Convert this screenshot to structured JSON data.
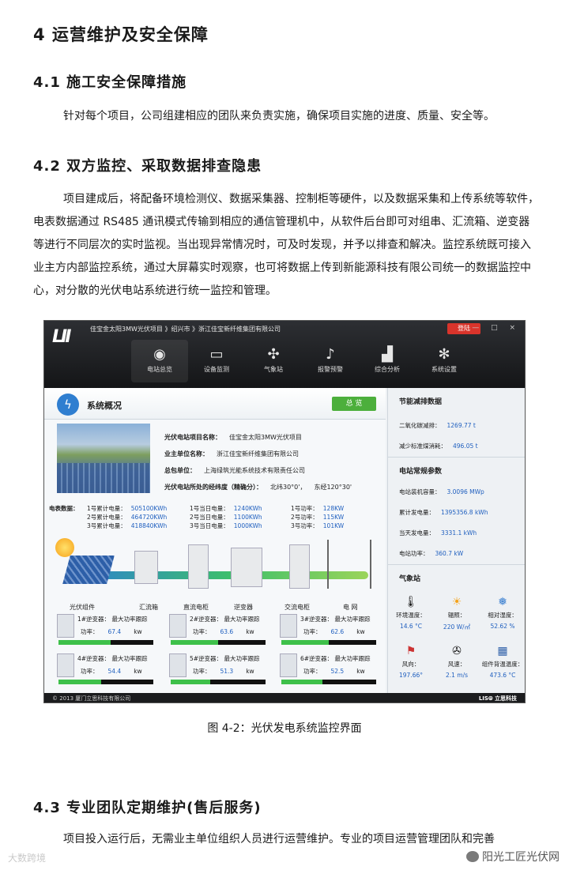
{
  "doc": {
    "h1": "4  运营维护及安全保障",
    "s41_title": "4.1  施工安全保障措施",
    "s41_text": "针对每个项目，公司组建相应的团队来负责实施，确保项目实施的进度、质量、安全等。",
    "s42_title": "4.2  双方监控、采取数据排查隐患",
    "s42_text": "项目建成后，将配备环境检测仪、数据采集器、控制柜等硬件，以及数据采集和上传系统等软件，电表数据通过 RS485 通讯模式传输到相应的通信管理机中，从软件后台即可对组串、汇流箱、逆变器等进行不同层次的实时监视。当出现异常情况时，可及时发现，并予以排查和解决。监控系统既可接入业主方内部监控系统，通过大屏幕实时观察，也可将数据上传到新能源科技有限公司统一的数据监控中心，对分散的光伏电站系统进行统一监控和管理。",
    "caption": "图 4-2：光伏发电系统监控界面",
    "s43_title": "4.3  专业团队定期维护(售后服务)",
    "s43_text": "项目投入运行后，无需业主单位组织人员进行运营维护。专业的项目运营管理团队和完善"
  },
  "watermarks": {
    "left": "大数跨境",
    "right": "阳光工匠光伏网"
  },
  "screen": {
    "logo": "LII",
    "breadcrumb": "佳宝金太阳3MW光伏项目 》绍兴市 》浙江佳宝新纤维集团有限公司",
    "window_controls": "— □ ×",
    "login": "登陆",
    "nav": [
      {
        "label": "电站总览",
        "icon": "eye-icon"
      },
      {
        "label": "设备监测",
        "icon": "monitor-icon"
      },
      {
        "label": "气象站",
        "icon": "windmill-icon"
      },
      {
        "label": "报警预警",
        "icon": "bell-icon"
      },
      {
        "label": "综合分析",
        "icon": "chart-icon"
      },
      {
        "label": "系统设置",
        "icon": "gear-icon"
      }
    ],
    "system_title": "系统概况",
    "overview_button": "总  览",
    "info": {
      "project_label": "光伏电站项目名称：",
      "project": "佳宝金太阳3MW光伏项目",
      "owner_label": "业主单位名称：",
      "owner": "浙江佳宝新纤维集团有限公司",
      "contractor_label": "总包单位：",
      "contractor": "上海绿筑光能系统技术有限责任公司",
      "coord_label": "光伏电站所处的经纬度（精确分）：",
      "lat": "北纬30°0'",
      "lon": "东经120°30'"
    },
    "meter_label": "电表数据：",
    "meters": [
      {
        "k": "1号累计电量：",
        "v": "505100KWh"
      },
      {
        "k": "2号累计电量：",
        "v": "464720KWh"
      },
      {
        "k": "3号累计电量：",
        "v": "418840KWh"
      },
      {
        "k": "1号当日电量：",
        "v": "1240KWh"
      },
      {
        "k": "2号当日电量：",
        "v": "1100KWh"
      },
      {
        "k": "3号当日电量：",
        "v": "1000KWh"
      },
      {
        "k": "1号功率：",
        "v": "128KW"
      },
      {
        "k": "2号功率：",
        "v": "115KW"
      },
      {
        "k": "3号功率：",
        "v": "101KW"
      }
    ],
    "flow_labels": [
      "光伏组件",
      "汇流箱",
      "直流电柜",
      "逆变器",
      "交流电柜",
      "电 网"
    ],
    "inverters": [
      {
        "name": "1#逆变器：",
        "mode": "最大功率跟踪",
        "power_label": "功率：",
        "power": "67.4",
        "unit": "kw",
        "level": 0.55
      },
      {
        "name": "2#逆变器：",
        "mode": "最大功率跟踪",
        "power_label": "功率：",
        "power": "63.6",
        "unit": "kw",
        "level": 0.5
      },
      {
        "name": "3#逆变器：",
        "mode": "最大功率跟踪",
        "power_label": "功率：",
        "power": "62.6",
        "unit": "kw",
        "level": 0.5
      },
      {
        "name": "4#逆变器：",
        "mode": "最大功率跟踪",
        "power_label": "功率：",
        "power": "54.4",
        "unit": "kw",
        "level": 0.45
      },
      {
        "name": "5#逆变器：",
        "mode": "最大功率跟踪",
        "power_label": "功率：",
        "power": "51.3",
        "unit": "kw",
        "level": 0.42
      },
      {
        "name": "6#逆变器：",
        "mode": "最大功率跟踪",
        "power_label": "功率：",
        "power": "52.5",
        "unit": "kw",
        "level": 0.43
      }
    ],
    "energy_title": "节能减排数据",
    "co2_label": "二氧化碳减排：",
    "co2": "1269.77 t",
    "coal_label": "减少标准煤消耗：",
    "coal": "496.05 t",
    "params_title": "电站常规参数",
    "params": [
      {
        "k": "电站装机容量：",
        "v": "3.0096 MWp"
      },
      {
        "k": "累计发电量：",
        "v": "1395356.8 kWh"
      },
      {
        "k": "当天发电量：",
        "v": "3331.1 kWh"
      },
      {
        "k": "电站功率：",
        "v": "360.7 kW"
      }
    ],
    "weather_title": "气象站",
    "weather": [
      {
        "k": "环境温度：",
        "v": "14.6 °C",
        "icon": "thermometer-icon"
      },
      {
        "k": "辐照：",
        "v": "220 W/㎡",
        "icon": "sun-icon"
      },
      {
        "k": "相对湿度：",
        "v": "52.62 %",
        "icon": "humidity-icon"
      },
      {
        "k": "风向：",
        "v": "197.66°",
        "icon": "wind-direction-icon"
      },
      {
        "k": "风速：",
        "v": "2.1 m/s",
        "icon": "anemometer-icon"
      },
      {
        "k": "组件背温温度：",
        "v": "473.6 °C",
        "icon": "panel-icon"
      }
    ],
    "footer_left": "© 2013 厦门立思科技有限公司",
    "footer_right": "LIS⦾ 立思科技"
  }
}
